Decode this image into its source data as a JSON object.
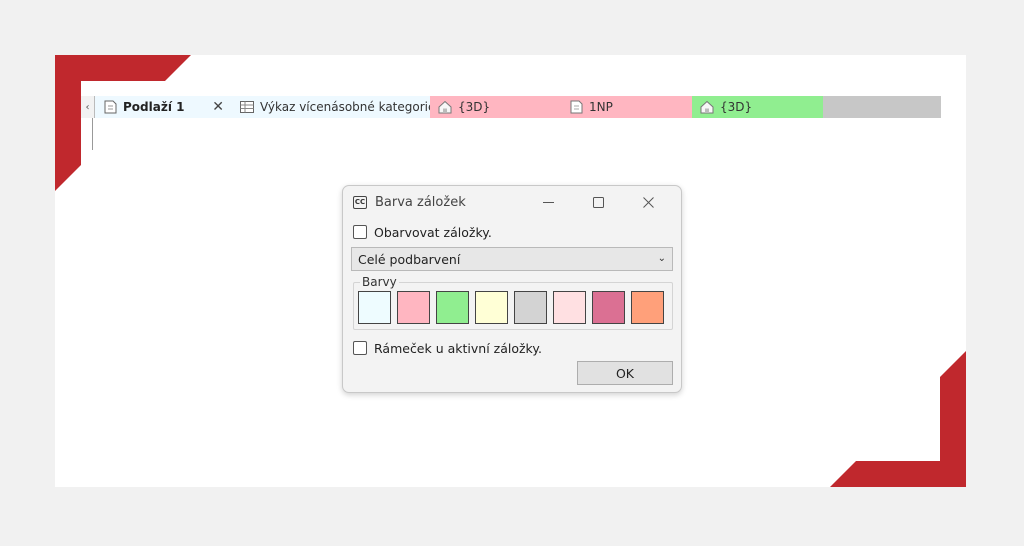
{
  "tabs": [
    {
      "label": "Podlaží 1",
      "icon": "floor-plan-icon",
      "color": "#eef9ff"
    },
    {
      "label": "Výkaz vícenásobné kategorie",
      "icon": "schedule-table-icon",
      "color": "#eef9ff"
    },
    {
      "label": "{3D}",
      "icon": "house-3d-icon",
      "color": "#ffb6c1"
    },
    {
      "label": "1NP",
      "icon": "floor-plan-icon",
      "color": "#ffb6c1"
    },
    {
      "label": "{3D}",
      "icon": "house-3d-icon",
      "color": "#90ee90"
    }
  ],
  "tab_close_glyph": "✕",
  "dialog": {
    "icon_text": "CC",
    "title": "Barva záložek",
    "color_tabs_label": "Obarvovat záložky.",
    "color_tabs_checked": false,
    "mode_value": "Celé podbarvení",
    "colors_group_label": "Barvy",
    "colors": [
      "#eefcff",
      "#ffb6c1",
      "#90ee90",
      "#ffffd6",
      "#d3d3d3",
      "#ffe0e2",
      "#db7093",
      "#ffa07a"
    ],
    "frame_label": "Rámeček u aktivní záložky.",
    "frame_checked": false,
    "ok_label": "OK"
  },
  "accent_color": "#c0282d"
}
